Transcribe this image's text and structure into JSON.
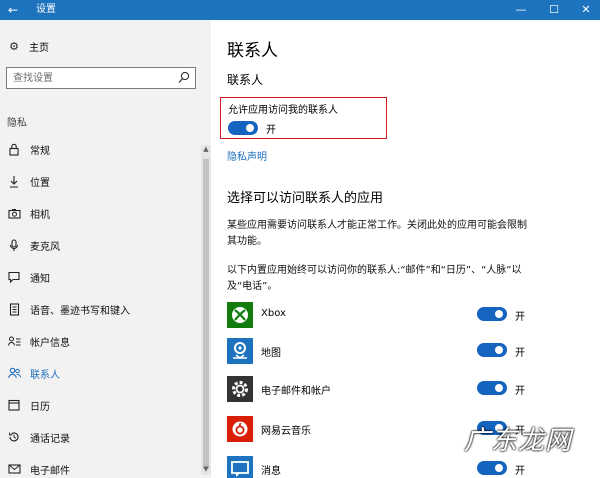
{
  "window": {
    "title": "设置",
    "back_icon": "arrow-left-icon",
    "minimize_icon": "minimize-icon",
    "maximize_icon": "maximize-icon",
    "close_icon": "close-icon"
  },
  "sidebar": {
    "home_label": "主页",
    "search_placeholder": "查找设置",
    "section_label": "隐私",
    "items": [
      {
        "label": "常规",
        "icon": "lock-icon"
      },
      {
        "label": "位置",
        "icon": "location-icon"
      },
      {
        "label": "相机",
        "icon": "camera-icon"
      },
      {
        "label": "麦克风",
        "icon": "microphone-icon"
      },
      {
        "label": "通知",
        "icon": "notification-icon"
      },
      {
        "label": "语音、墨迹书写和键入",
        "icon": "speech-icon"
      },
      {
        "label": "帐户信息",
        "icon": "account-info-icon"
      },
      {
        "label": "联系人",
        "icon": "contacts-icon",
        "active": true
      },
      {
        "label": "日历",
        "icon": "calendar-icon"
      },
      {
        "label": "通话记录",
        "icon": "call-history-icon"
      },
      {
        "label": "电子邮件",
        "icon": "email-icon"
      }
    ]
  },
  "main": {
    "title": "联系人",
    "subtitle": "联系人",
    "allow_label": "允许应用访问我的联系人",
    "allow_toggle": {
      "state": "on",
      "label": "开"
    },
    "privacy_link": "隐私声明",
    "choose_heading": "选择可以访问联系人的应用",
    "desc1": "某些应用需要访问联系人才能正常工作。关闭此处的应用可能会限制其功能。",
    "desc2": "以下内置应用始终可以访问你的联系人:“邮件”和“日历”、“人脉”以及“电话”。",
    "apps": [
      {
        "name": "Xbox",
        "toggle": "开",
        "icon": "xbox-icon",
        "color": "#107c10"
      },
      {
        "name": "地图",
        "toggle": "开",
        "icon": "maps-icon",
        "color": "#1e73be"
      },
      {
        "name": "电子邮件和帐户",
        "toggle": "开",
        "icon": "gear-icon",
        "color": "#333333"
      },
      {
        "name": "网易云音乐",
        "toggle": "开",
        "icon": "netease-music-icon",
        "color": "#d81e06"
      },
      {
        "name": "消息",
        "toggle": "开",
        "icon": "messaging-icon",
        "color": "#1e73be"
      }
    ]
  },
  "watermark": "广东龙网",
  "colors": {
    "titlebar": "#1e73be",
    "accent": "#1e6fc0",
    "toggle_on": "#1565c0",
    "highlight_border": "#d5161d",
    "sidebar_bg": "#f2f2f2"
  }
}
